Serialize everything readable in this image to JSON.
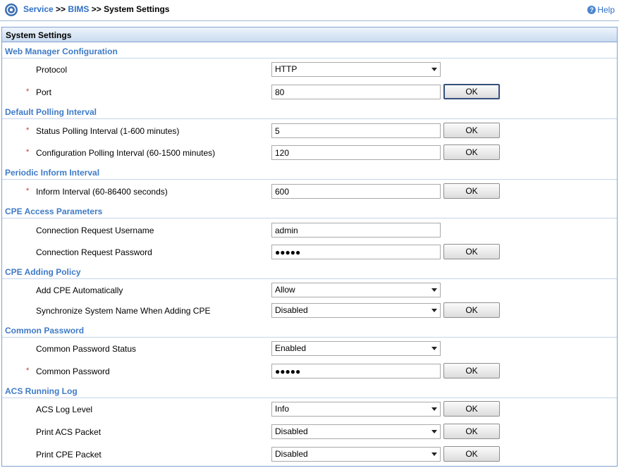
{
  "breadcrumb": {
    "service": "Service",
    "sep1": ">>",
    "bims": "BIMS",
    "sep2": ">>",
    "current": "System Settings"
  },
  "help_label": "Help",
  "panel_title": "System Settings",
  "required_mark": "*",
  "ok_label": "OK",
  "sections": {
    "web_manager": {
      "title": "Web Manager Configuration",
      "protocol": {
        "label": "Protocol",
        "value": "HTTP"
      },
      "port": {
        "label": "Port",
        "value": "80"
      }
    },
    "polling": {
      "title": "Default Polling Interval",
      "status": {
        "label": "Status Polling Interval (1-600 minutes)",
        "value": "5"
      },
      "config": {
        "label": "Configuration Polling Interval (60-1500 minutes)",
        "value": "120"
      }
    },
    "inform": {
      "title": "Periodic Inform Interval",
      "interval": {
        "label": "Inform Interval (60-86400 seconds)",
        "value": "600"
      }
    },
    "cpe_access": {
      "title": "CPE Access Parameters",
      "username": {
        "label": "Connection Request Username",
        "value": "admin"
      },
      "password": {
        "label": "Connection Request Password",
        "value": "●●●●●"
      }
    },
    "cpe_adding": {
      "title": "CPE Adding Policy",
      "auto": {
        "label": "Add CPE Automatically",
        "value": "Allow"
      },
      "sync": {
        "label": "Synchronize System Name When Adding CPE",
        "value": "Disabled"
      }
    },
    "common_password": {
      "title": "Common Password",
      "status": {
        "label": "Common Password Status",
        "value": "Enabled"
      },
      "password": {
        "label": "Common Password",
        "value": "●●●●●"
      }
    },
    "acs_log": {
      "title": "ACS Running Log",
      "level": {
        "label": "ACS Log Level",
        "value": "Info"
      },
      "acs_packet": {
        "label": "Print ACS Packet",
        "value": "Disabled"
      },
      "cpe_packet": {
        "label": "Print CPE Packet",
        "value": "Disabled"
      }
    }
  }
}
